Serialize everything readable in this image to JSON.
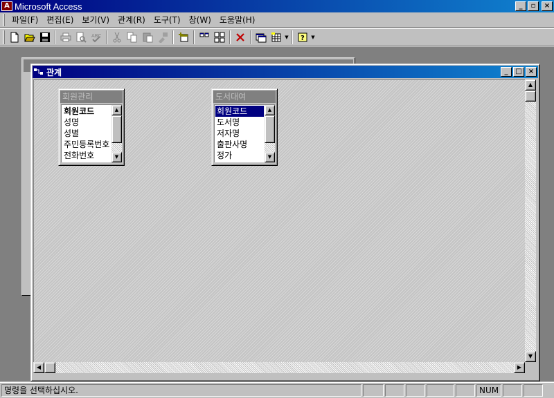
{
  "app": {
    "title": "Microsoft Access",
    "icon_label": "A",
    "controls": {
      "minimize": "_",
      "restore": "▫",
      "close": "×"
    }
  },
  "menu": {
    "items": [
      {
        "label": "파일(F)"
      },
      {
        "label": "편집(E)"
      },
      {
        "label": "보기(V)"
      },
      {
        "label": "관계(R)"
      },
      {
        "label": "도구(T)"
      },
      {
        "label": "창(W)"
      },
      {
        "label": "도움말(H)"
      }
    ]
  },
  "toolbar": {
    "icons": [
      "new-icon",
      "open-icon",
      "save-icon",
      "print-icon",
      "print-preview-icon",
      "spelling-icon",
      "cut-icon",
      "copy-icon",
      "paste-icon",
      "format-painter-icon",
      "show-table-icon",
      "show-direct-icon",
      "show-all-icon",
      "delete-icon",
      "database-window-icon",
      "new-object-icon",
      "help-icon"
    ]
  },
  "relationships_window": {
    "title": "관계",
    "tables": [
      {
        "name": "회원관리",
        "fields": [
          {
            "label": "회원코드",
            "bold": true,
            "selected": false
          },
          {
            "label": "성명",
            "bold": false,
            "selected": false
          },
          {
            "label": "성별",
            "bold": false,
            "selected": false
          },
          {
            "label": "주민등록번호",
            "bold": false,
            "selected": false
          },
          {
            "label": "전화번호",
            "bold": false,
            "selected": false
          }
        ]
      },
      {
        "name": "도서대여",
        "fields": [
          {
            "label": "회원코드",
            "bold": false,
            "selected": true
          },
          {
            "label": "도서명",
            "bold": false,
            "selected": false
          },
          {
            "label": "저자명",
            "bold": false,
            "selected": false
          },
          {
            "label": "출판사명",
            "bold": false,
            "selected": false
          },
          {
            "label": "정가",
            "bold": false,
            "selected": false
          }
        ]
      }
    ]
  },
  "status": {
    "message": "명령을 선택하십시오.",
    "num_indicator": "NUM"
  }
}
